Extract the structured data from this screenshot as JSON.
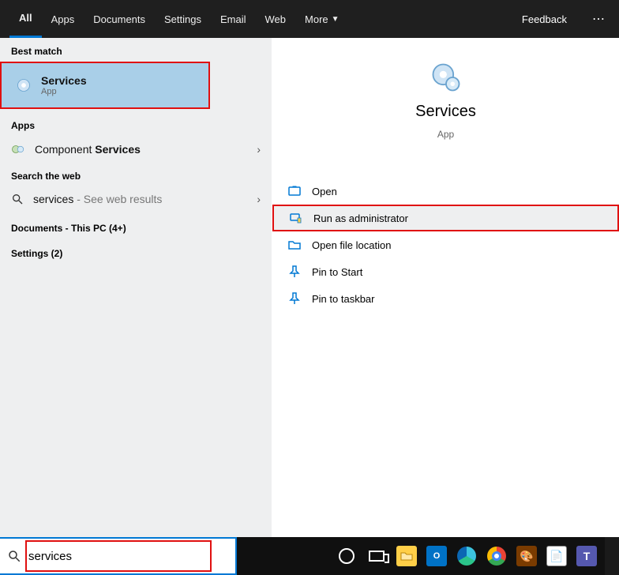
{
  "tabs": {
    "all": "All",
    "apps": "Apps",
    "documents": "Documents",
    "settings": "Settings",
    "email": "Email",
    "web": "Web",
    "more": "More",
    "feedback": "Feedback"
  },
  "left": {
    "best_match_header": "Best match",
    "best_match": {
      "title": "Services",
      "subtitle": "App"
    },
    "apps_header": "Apps",
    "apps_item_prefix": "Component ",
    "apps_item_bold": "Services",
    "search_web_header": "Search the web",
    "web_item_prefix": "services",
    "web_item_suffix": " - See web results",
    "documents_header": "Documents - This PC (4+)",
    "settings_header": "Settings (2)"
  },
  "preview": {
    "title": "Services",
    "subtitle": "App",
    "actions": {
      "open": "Open",
      "run_admin": "Run as administrator",
      "open_loc": "Open file location",
      "pin_start": "Pin to Start",
      "pin_taskbar": "Pin to taskbar"
    }
  },
  "search": {
    "value": "services"
  }
}
